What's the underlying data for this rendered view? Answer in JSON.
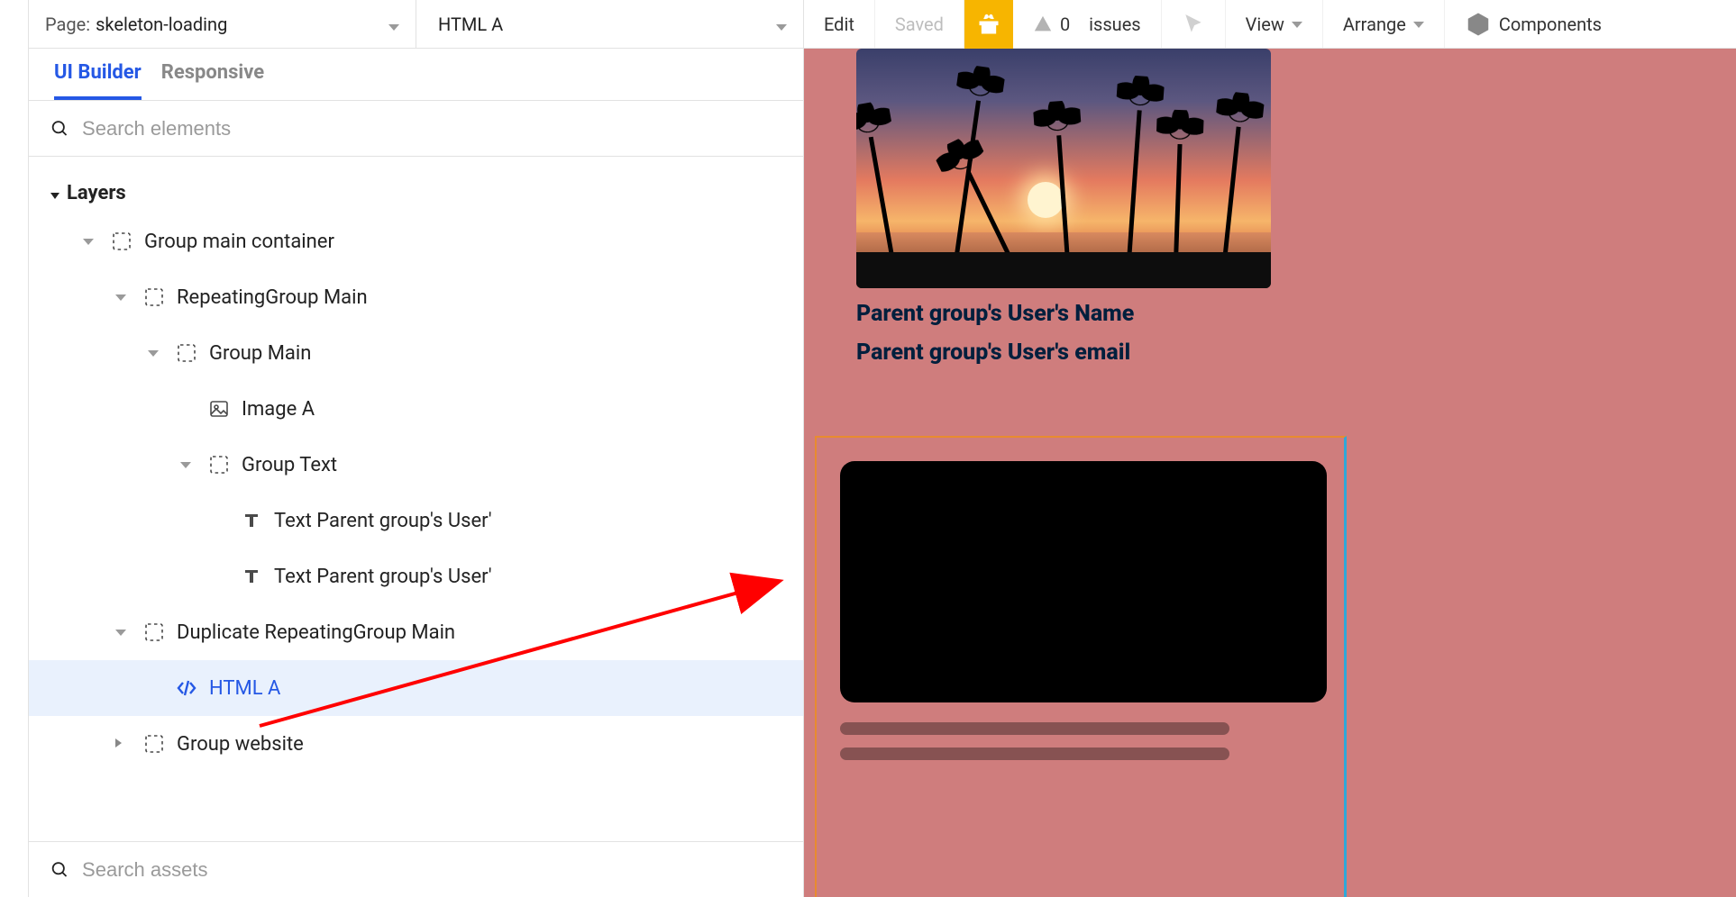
{
  "page_selector": {
    "prefix": "Page:",
    "value": "skeleton-loading"
  },
  "element_selector": {
    "value": "HTML A"
  },
  "tabs": {
    "ui_builder": "UI Builder",
    "responsive": "Responsive"
  },
  "search": {
    "elements_placeholder": "Search elements",
    "assets_placeholder": "Search assets"
  },
  "layers_heading": "Layers",
  "tree": {
    "group_main_container": "Group main container",
    "repeating_group_main": "RepeatingGroup Main",
    "group_main": "Group Main",
    "image_a": "Image A",
    "group_text": "Group Text",
    "text_name": "Text Parent group's User'",
    "text_email": "Text Parent group's User'",
    "duplicate_rg": "Duplicate RepeatingGroup Main",
    "html_a": "HTML A",
    "group_website": "Group website"
  },
  "toolbar": {
    "edit": "Edit",
    "saved": "Saved",
    "issues_count": "0",
    "issues_label": "issues",
    "view": "View",
    "arrange": "Arrange",
    "components": "Components"
  },
  "canvas": {
    "card1_name": "Parent group's User's Name",
    "card1_email": "Parent group's User's email"
  },
  "colors": {
    "accent": "#2558e5",
    "gift": "#f7b500",
    "canvas_bg": "#cf7d7d",
    "sel_border": "#e88b2f"
  }
}
